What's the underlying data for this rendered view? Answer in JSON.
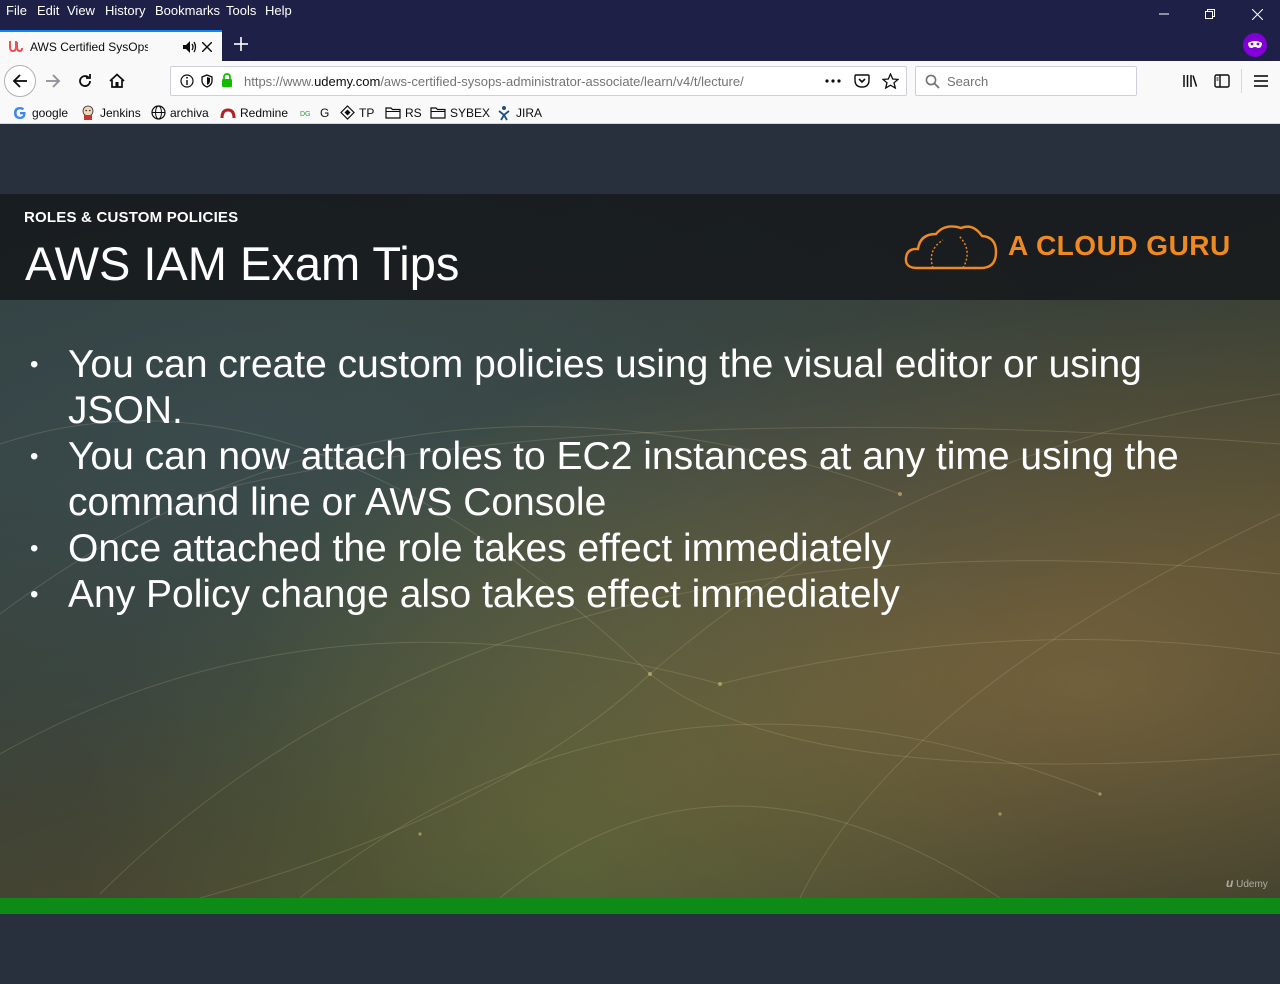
{
  "menubar": {
    "items": [
      {
        "label": "File"
      },
      {
        "label": "Edit"
      },
      {
        "label": "View"
      },
      {
        "label": "History"
      },
      {
        "label": "Bookmarks"
      },
      {
        "label": "Tools"
      },
      {
        "label": "Help"
      }
    ]
  },
  "tab": {
    "title": "AWS Certified SysOps Administrator - Associate | Udemy",
    "icon": "udemy-icon",
    "audio_icon": "speaker-icon"
  },
  "navbar": {
    "url_prefix": "https://www.",
    "url_host": "udemy.com",
    "url_path": "/aws-certified-sysops-administrator-associate/learn/v4/t/lecture/",
    "search_placeholder": "Search"
  },
  "bookmarks": [
    {
      "label": "google",
      "icon": "google-icon"
    },
    {
      "label": "Jenkins",
      "icon": "jenkins-icon"
    },
    {
      "label": "archiva",
      "icon": "globe-icon"
    },
    {
      "label": "Redmine",
      "icon": "redmine-icon"
    },
    {
      "label": "G",
      "icon": "bookmark-icon"
    },
    {
      "label": "TP",
      "icon": "tp-icon"
    },
    {
      "label": "RS",
      "icon": "folder-icon"
    },
    {
      "label": "SYBEX",
      "icon": "folder-icon"
    },
    {
      "label": "JIRA",
      "icon": "jira-icon"
    }
  ],
  "slide": {
    "eyebrow": "ROLES & CUSTOM POLICIES",
    "title": "AWS IAM Exam Tips",
    "brand": "A CLOUD GURU",
    "bullets": [
      "You can create custom policies using the visual editor or using JSON.",
      "You can now attach roles to EC2 instances at any time using the command line or AWS Console",
      "Once attached the role takes effect immediately",
      "Any Policy change also takes effect immediately"
    ],
    "watermark": "Udemy"
  },
  "player": {
    "progress_percent": 100
  },
  "colors": {
    "titlebar": "#1e2048",
    "accent": "#0a84ff",
    "brand_orange": "#ef8a22",
    "progress": "#0e8a16"
  }
}
